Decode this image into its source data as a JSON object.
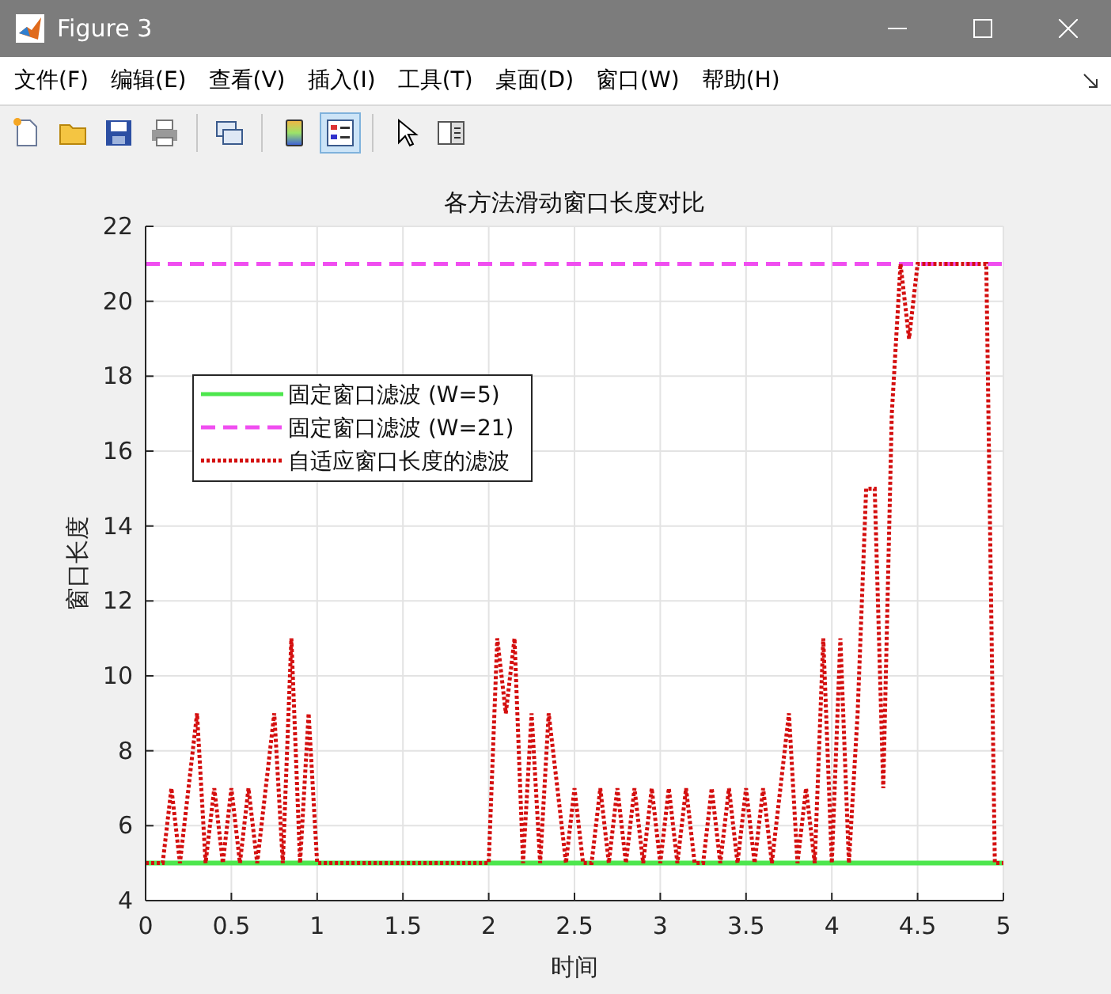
{
  "window": {
    "title": "Figure 3"
  },
  "menu": [
    "文件(F)",
    "编辑(E)",
    "查看(V)",
    "插入(I)",
    "工具(T)",
    "桌面(D)",
    "窗口(W)",
    "帮助(H)"
  ],
  "toolbar": [
    {
      "kind": "new",
      "selected": false
    },
    {
      "kind": "open",
      "selected": false
    },
    {
      "kind": "save",
      "selected": false
    },
    {
      "kind": "print",
      "selected": false
    },
    {
      "kind": "divider"
    },
    {
      "kind": "link",
      "selected": false
    },
    {
      "kind": "divider"
    },
    {
      "kind": "colorbar",
      "selected": false
    },
    {
      "kind": "legend",
      "selected": true
    },
    {
      "kind": "divider"
    },
    {
      "kind": "pointer",
      "selected": false
    },
    {
      "kind": "inspector",
      "selected": false
    }
  ],
  "chart_data": {
    "type": "line",
    "title": "各方法滑动窗口长度对比",
    "xlabel": "时间",
    "ylabel": "窗口长度",
    "xlim": [
      0,
      5
    ],
    "ylim": [
      4,
      22
    ],
    "grid": true,
    "legend": true,
    "xticks": [
      {
        "value": 0,
        "label": "0"
      },
      {
        "value": 0.5,
        "label": "0.5"
      },
      {
        "value": 1,
        "label": "1"
      },
      {
        "value": 1.5,
        "label": "1.5"
      },
      {
        "value": 2,
        "label": "2"
      },
      {
        "value": 2.5,
        "label": "2.5"
      },
      {
        "value": 3,
        "label": "3"
      },
      {
        "value": 3.5,
        "label": "3.5"
      },
      {
        "value": 4,
        "label": "4"
      },
      {
        "value": 4.5,
        "label": "4.5"
      },
      {
        "value": 5,
        "label": "5"
      }
    ],
    "yticks": [
      4,
      6,
      8,
      10,
      12,
      14,
      16,
      18,
      20,
      22
    ],
    "x": [
      0,
      0.05,
      0.1,
      0.15,
      0.2,
      0.25,
      0.3,
      0.35,
      0.4,
      0.45,
      0.5,
      0.55,
      0.6,
      0.65,
      0.7,
      0.75,
      0.8,
      0.85,
      0.9,
      0.95,
      1,
      1.05,
      1.1,
      1.15,
      1.2,
      1.25,
      1.3,
      1.35,
      1.4,
      1.45,
      1.5,
      1.55,
      1.6,
      1.65,
      1.7,
      1.75,
      1.8,
      1.85,
      1.9,
      1.95,
      2,
      2.05,
      2.1,
      2.15,
      2.2,
      2.25,
      2.3,
      2.35,
      2.4,
      2.45,
      2.5,
      2.55,
      2.6,
      2.65,
      2.7,
      2.75,
      2.8,
      2.85,
      2.9,
      2.95,
      3,
      3.05,
      3.1,
      3.15,
      3.2,
      3.25,
      3.3,
      3.35,
      3.4,
      3.45,
      3.5,
      3.55,
      3.6,
      3.65,
      3.7,
      3.75,
      3.8,
      3.85,
      3.9,
      3.95,
      4,
      4.05,
      4.1,
      4.15,
      4.2,
      4.25,
      4.3,
      4.35,
      4.4,
      4.45,
      4.5,
      4.55,
      4.6,
      4.65,
      4.7,
      4.75,
      4.8,
      4.85,
      4.9,
      4.95,
      5
    ],
    "series": [
      {
        "name": "固定窗口滤波 (W=5)",
        "color": "#4de64d",
        "line_style": "solid",
        "values": [
          5,
          5,
          5,
          5,
          5,
          5,
          5,
          5,
          5,
          5,
          5,
          5,
          5,
          5,
          5,
          5,
          5,
          5,
          5,
          5,
          5,
          5,
          5,
          5,
          5,
          5,
          5,
          5,
          5,
          5,
          5,
          5,
          5,
          5,
          5,
          5,
          5,
          5,
          5,
          5,
          5,
          5,
          5,
          5,
          5,
          5,
          5,
          5,
          5,
          5,
          5,
          5,
          5,
          5,
          5,
          5,
          5,
          5,
          5,
          5,
          5,
          5,
          5,
          5,
          5,
          5,
          5,
          5,
          5,
          5,
          5,
          5,
          5,
          5,
          5,
          5,
          5,
          5,
          5,
          5,
          5,
          5,
          5,
          5,
          5,
          5,
          5,
          5,
          5,
          5,
          5,
          5,
          5,
          5,
          5,
          5,
          5,
          5,
          5,
          5,
          5
        ]
      },
      {
        "name": "固定窗口滤波 (W=21)",
        "color": "#f04ef0",
        "line_style": "dashed",
        "values": [
          21,
          21,
          21,
          21,
          21,
          21,
          21,
          21,
          21,
          21,
          21,
          21,
          21,
          21,
          21,
          21,
          21,
          21,
          21,
          21,
          21,
          21,
          21,
          21,
          21,
          21,
          21,
          21,
          21,
          21,
          21,
          21,
          21,
          21,
          21,
          21,
          21,
          21,
          21,
          21,
          21,
          21,
          21,
          21,
          21,
          21,
          21,
          21,
          21,
          21,
          21,
          21,
          21,
          21,
          21,
          21,
          21,
          21,
          21,
          21,
          21,
          21,
          21,
          21,
          21,
          21,
          21,
          21,
          21,
          21,
          21,
          21,
          21,
          21,
          21,
          21,
          21,
          21,
          21,
          21,
          21,
          21,
          21,
          21,
          21,
          21,
          21,
          21,
          21,
          21,
          21,
          21,
          21,
          21,
          21,
          21,
          21,
          21,
          21,
          21,
          21
        ]
      },
      {
        "name": "自适应窗口长度的滤波",
        "color": "#d40f0f",
        "line_style": "dotted",
        "values": [
          5,
          5,
          5,
          7,
          5,
          7,
          9,
          5,
          7,
          5,
          7,
          5,
          7,
          5,
          7,
          9,
          5,
          11,
          5,
          9,
          5,
          5,
          5,
          5,
          5,
          5,
          5,
          5,
          5,
          5,
          5,
          5,
          5,
          5,
          5,
          5,
          5,
          5,
          5,
          5,
          5,
          11,
          9,
          11,
          5,
          9,
          5,
          9,
          7,
          5,
          7,
          5,
          5,
          7,
          5,
          7,
          5,
          7,
          5,
          7,
          5,
          7,
          5,
          7,
          5,
          5,
          7,
          5,
          7,
          5,
          7,
          5,
          7,
          5,
          7,
          9,
          5,
          7,
          5,
          11,
          5,
          11,
          5,
          9,
          15,
          15,
          7,
          17,
          21,
          19,
          21,
          21,
          21,
          21,
          21,
          21,
          21,
          21,
          21,
          5,
          5
        ]
      }
    ]
  }
}
